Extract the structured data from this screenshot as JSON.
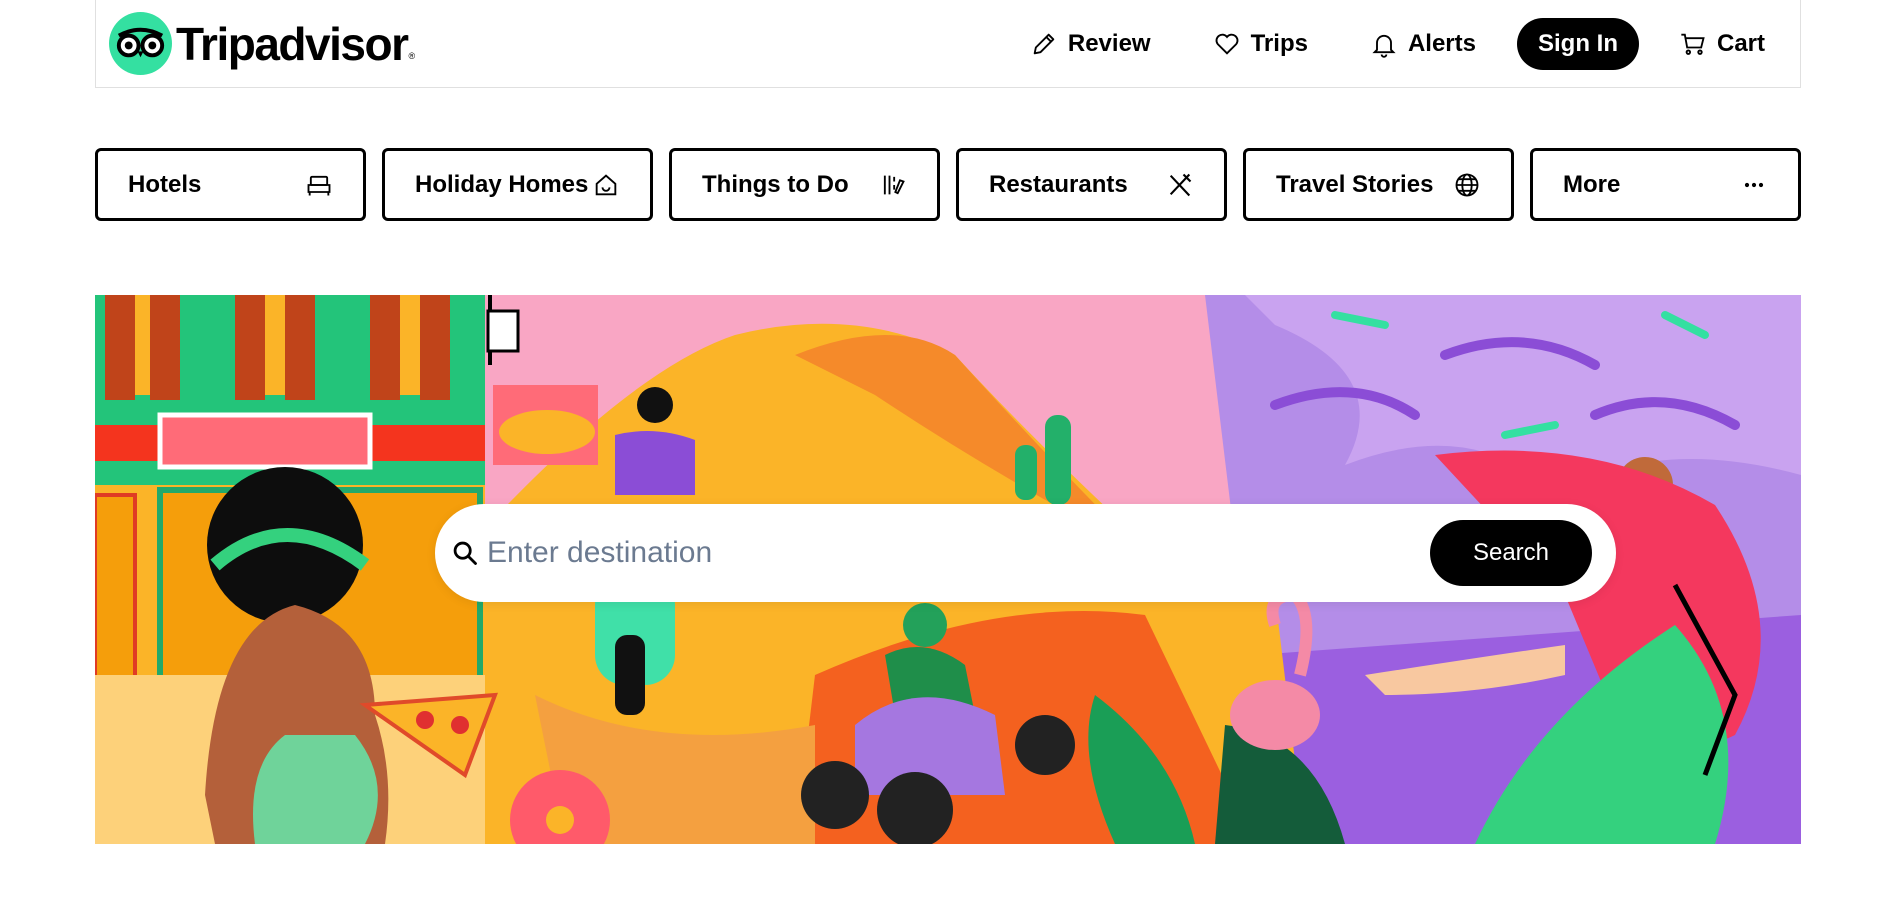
{
  "brand": {
    "name": "Tripadvisor",
    "tm": "®",
    "logo_color": "#34e0a1"
  },
  "nav": {
    "review": {
      "label": "Review",
      "icon": "pencil-icon"
    },
    "trips": {
      "label": "Trips",
      "icon": "heart-icon"
    },
    "alerts": {
      "label": "Alerts",
      "icon": "bell-icon"
    },
    "signin": {
      "label": "Sign In"
    },
    "cart": {
      "label": "Cart",
      "icon": "cart-icon"
    }
  },
  "categories": [
    {
      "label": "Hotels",
      "icon": "bed-icon"
    },
    {
      "label": "Holiday Homes",
      "icon": "house-icon"
    },
    {
      "label": "Things to Do",
      "icon": "ticket-icon"
    },
    {
      "label": "Restaurants",
      "icon": "fork-knife-icon"
    },
    {
      "label": "Travel Stories",
      "icon": "globe-icon"
    },
    {
      "label": "More",
      "icon": "ellipsis-icon"
    }
  ],
  "search": {
    "placeholder": "Enter destination",
    "button_label": "Search"
  },
  "colors": {
    "accent": "#34e0a1",
    "button": "#000000",
    "placeholder": "#6b7a90"
  }
}
